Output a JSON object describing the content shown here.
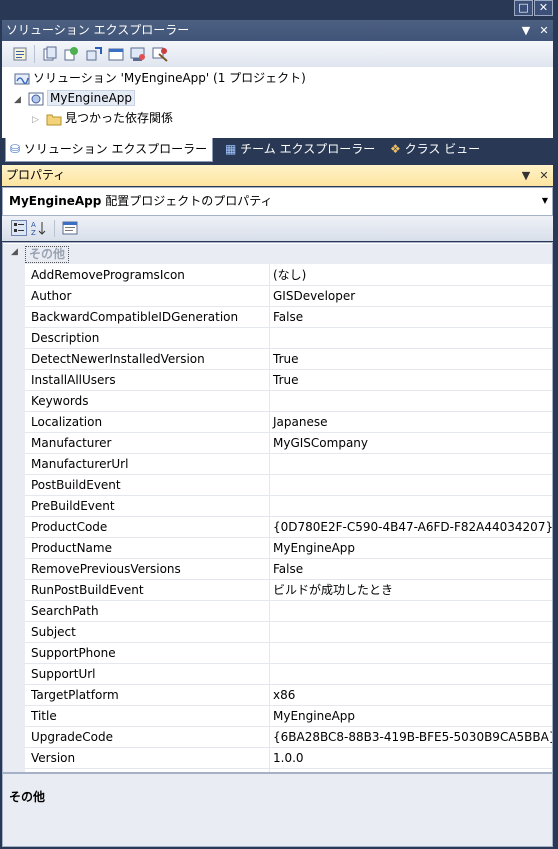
{
  "window_buttons": {
    "restore": "□",
    "close": "✕"
  },
  "solution_explorer": {
    "title": "ソリューション エクスプローラー",
    "tree": {
      "solution": "ソリューション 'MyEngineApp' (1 プロジェクト)",
      "project": "MyEngineApp",
      "dependencies": "見つかった依存関係"
    },
    "tabs": [
      {
        "label": "ソリューション エクスプローラー"
      },
      {
        "label": "チーム エクスプローラー"
      },
      {
        "label": "クラス ビュー"
      }
    ]
  },
  "properties": {
    "title": "プロパティ",
    "object_name": "MyEngineApp",
    "object_type": "配置プロジェクトのプロパティ",
    "category": "その他",
    "rows": [
      {
        "key": "AddRemoveProgramsIcon",
        "value": "(なし)"
      },
      {
        "key": "Author",
        "value": "GISDeveloper"
      },
      {
        "key": "BackwardCompatibleIDGeneration",
        "value": "False"
      },
      {
        "key": "Description",
        "value": ""
      },
      {
        "key": "DetectNewerInstalledVersion",
        "value": "True"
      },
      {
        "key": "InstallAllUsers",
        "value": "True"
      },
      {
        "key": "Keywords",
        "value": ""
      },
      {
        "key": "Localization",
        "value": "Japanese"
      },
      {
        "key": "Manufacturer",
        "value": "MyGISCompany"
      },
      {
        "key": "ManufacturerUrl",
        "value": ""
      },
      {
        "key": "PostBuildEvent",
        "value": ""
      },
      {
        "key": "PreBuildEvent",
        "value": ""
      },
      {
        "key": "ProductCode",
        "value": "{0D780E2F-C590-4B47-A6FD-F82A44034207}"
      },
      {
        "key": "ProductName",
        "value": "MyEngineApp"
      },
      {
        "key": "RemovePreviousVersions",
        "value": "False"
      },
      {
        "key": "RunPostBuildEvent",
        "value": "ビルドが成功したとき"
      },
      {
        "key": "SearchPath",
        "value": ""
      },
      {
        "key": "Subject",
        "value": ""
      },
      {
        "key": "SupportPhone",
        "value": ""
      },
      {
        "key": "SupportUrl",
        "value": ""
      },
      {
        "key": "TargetPlatform",
        "value": "x86"
      },
      {
        "key": "Title",
        "value": "MyEngineApp"
      },
      {
        "key": "UpgradeCode",
        "value": "{6BA28BC8-88B3-419B-BFE5-5030B9CA5BBA}"
      },
      {
        "key": "Version",
        "value": "1.0.0"
      }
    ],
    "description_title": "その他"
  }
}
